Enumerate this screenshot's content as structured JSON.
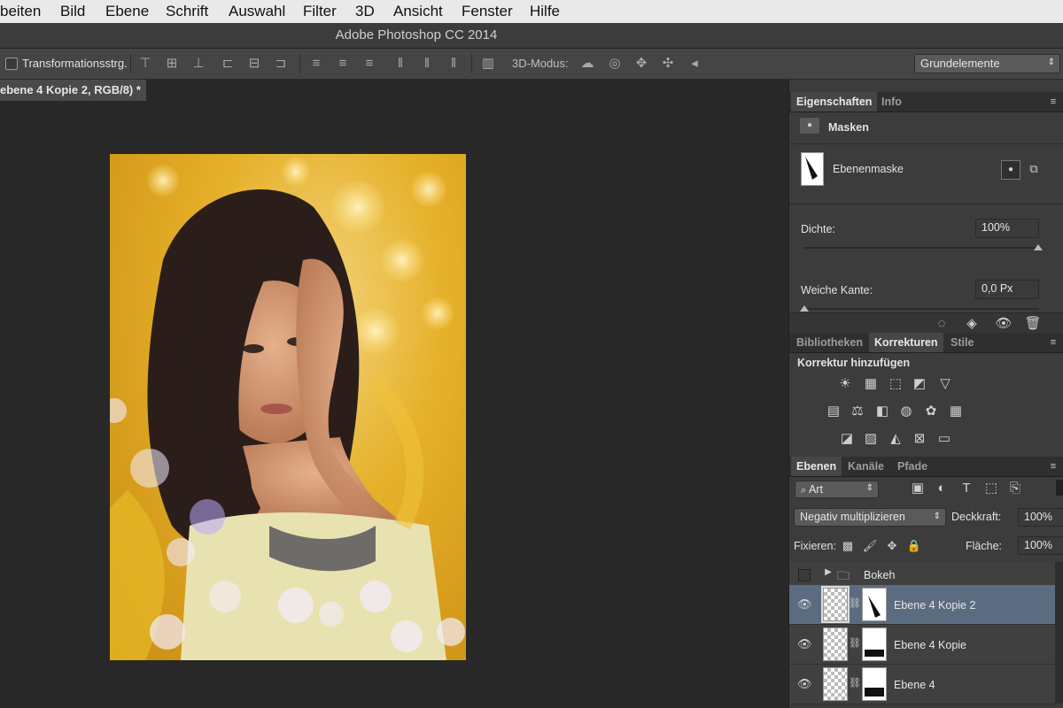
{
  "menubar": {
    "items": [
      "beiten",
      "Bild",
      "Ebene",
      "Schrift",
      "Auswahl",
      "Filter",
      "3D",
      "Ansicht",
      "Fenster",
      "Hilfe"
    ]
  },
  "window": {
    "title": "Adobe Photoshop CC 2014"
  },
  "options": {
    "transform_label": "Transformationsstrg.",
    "mode3d_label": "3D-Modus:",
    "workspace": "Grundelemente"
  },
  "document": {
    "tab_label": "ebene 4 Kopie 2, RGB/8) *"
  },
  "properties": {
    "tabs": [
      "Eigenschaften",
      "Info"
    ],
    "section": "Masken",
    "mask_label": "Ebenenmaske",
    "density_label": "Dichte:",
    "density_value": "100%",
    "feather_label": "Weiche Kante:",
    "feather_value": "0,0 Px"
  },
  "adjustments": {
    "tabs": [
      "Bibliotheken",
      "Korrekturen",
      "Stile"
    ],
    "heading": "Korrektur hinzufügen"
  },
  "layers": {
    "tabs": [
      "Ebenen",
      "Kanäle",
      "Pfade"
    ],
    "filter_label": "Art",
    "blend_mode": "Negativ multiplizieren",
    "opacity_label": "Deckkraft:",
    "opacity_value": "100%",
    "lock_label": "Fixieren:",
    "fill_label": "Fläche:",
    "fill_value": "100%",
    "items": [
      {
        "name": "Bokeh"
      },
      {
        "name": "Ebene 4 Kopie 2"
      },
      {
        "name": "Ebene 4 Kopie"
      },
      {
        "name": "Ebene 4"
      }
    ]
  }
}
